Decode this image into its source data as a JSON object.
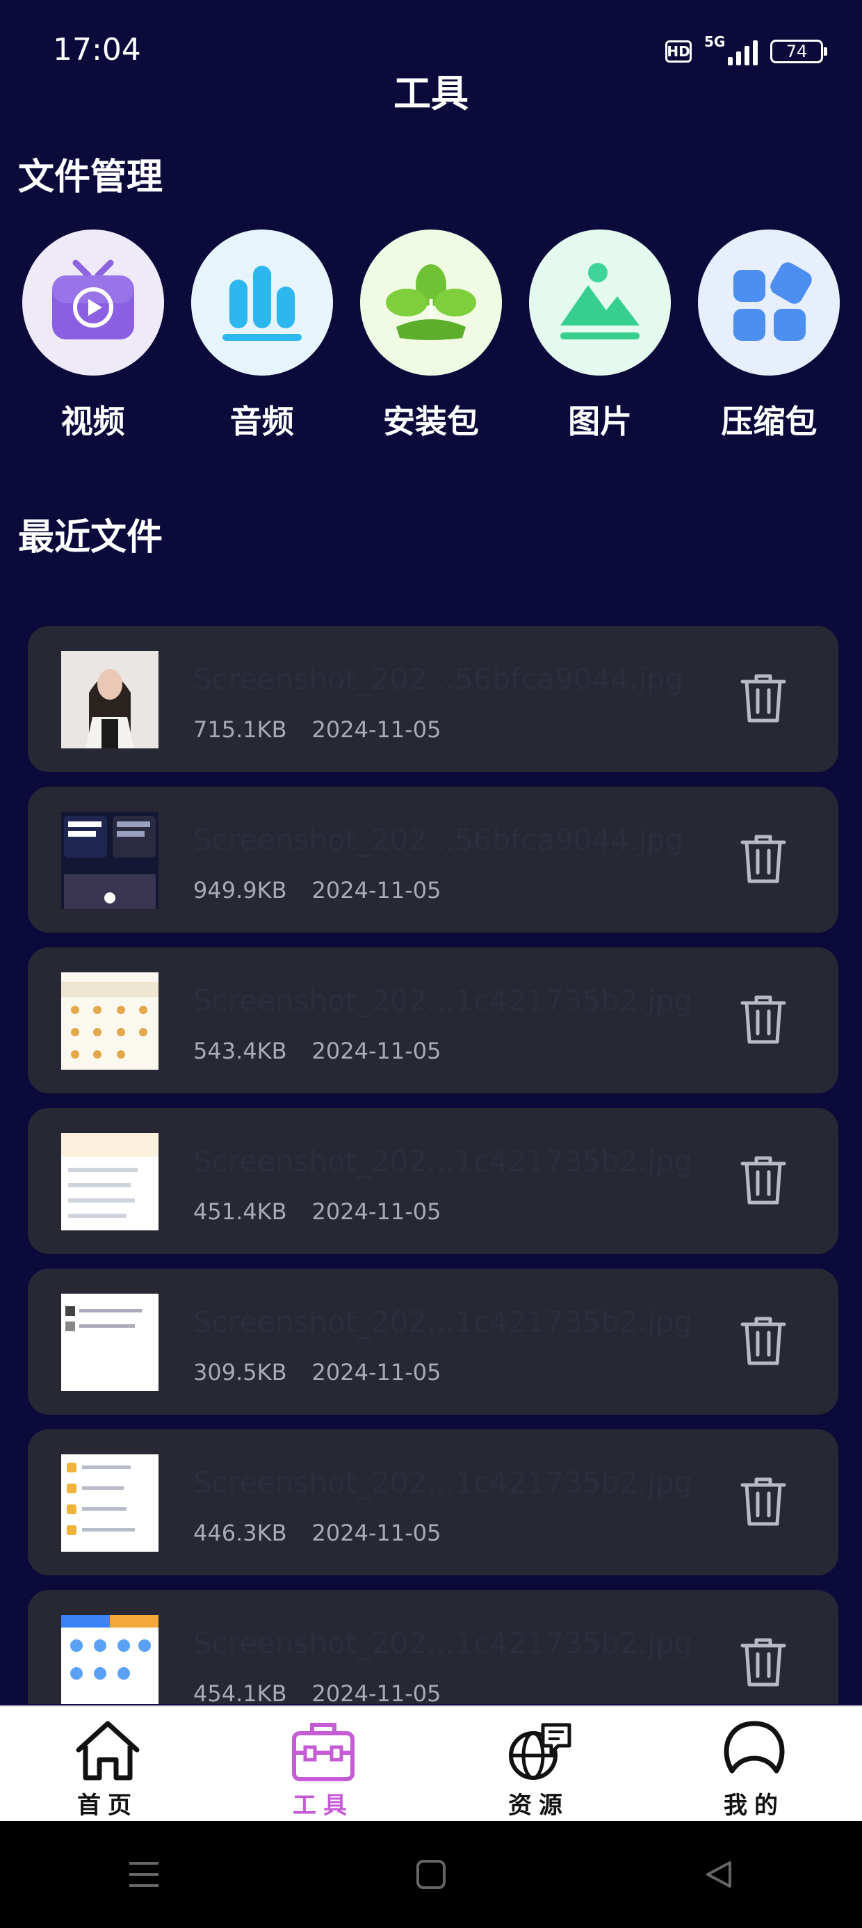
{
  "status": {
    "time": "17:04",
    "hd": "HD",
    "network": "5G",
    "battery": "74"
  },
  "page_title": "工具",
  "file_management": {
    "title": "文件管理",
    "categories": [
      {
        "label": "视频",
        "icon": "video-tv-icon"
      },
      {
        "label": "音频",
        "icon": "audio-bars-icon"
      },
      {
        "label": "安装包",
        "icon": "package-plant-icon"
      },
      {
        "label": "图片",
        "icon": "image-mountain-icon"
      },
      {
        "label": "压缩包",
        "icon": "archive-grid-icon"
      }
    ]
  },
  "recent_files": {
    "title": "最近文件",
    "items": [
      {
        "name": "Screenshot_202...56bfca9044.jpg",
        "size": "715.1KB",
        "date": "2024-11-05"
      },
      {
        "name": "Screenshot_202...56bfca9044.jpg",
        "size": "949.9KB",
        "date": "2024-11-05"
      },
      {
        "name": "Screenshot_202...1c421735b2.jpg",
        "size": "543.4KB",
        "date": "2024-11-05"
      },
      {
        "name": "Screenshot_202...1c421735b2.jpg",
        "size": "451.4KB",
        "date": "2024-11-05"
      },
      {
        "name": "Screenshot_202...1c421735b2.jpg",
        "size": "309.5KB",
        "date": "2024-11-05"
      },
      {
        "name": "Screenshot_202...1c421735b2.jpg",
        "size": "446.3KB",
        "date": "2024-11-05"
      },
      {
        "name": "Screenshot_202...1c421735b2.jpg",
        "size": "454.1KB",
        "date": "2024-11-05"
      }
    ]
  },
  "tabs": [
    {
      "label": "首页",
      "icon": "home-icon",
      "active": false
    },
    {
      "label": "工具",
      "icon": "toolbox-icon",
      "active": true
    },
    {
      "label": "资源",
      "icon": "globe-icon",
      "active": false
    },
    {
      "label": "我的",
      "icon": "user-icon",
      "active": false
    }
  ],
  "colors": {
    "background": "#0b0a3a",
    "card": "#272834",
    "accent": "#c65bd6"
  }
}
